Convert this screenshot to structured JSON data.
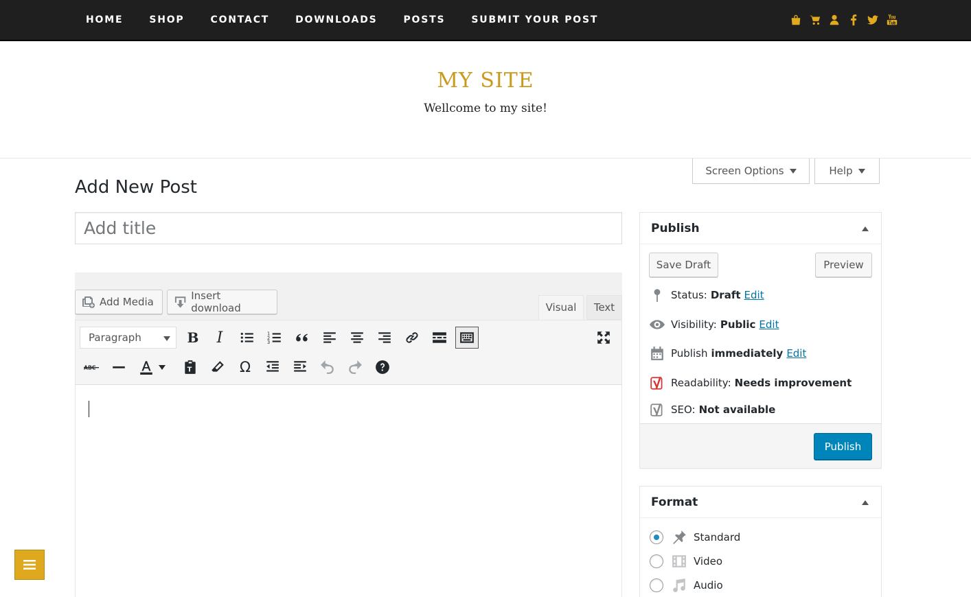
{
  "nav": {
    "items": [
      "HOME",
      "SHOP",
      "CONTACT",
      "DOWNLOADS",
      "POSTS",
      "SUBMIT YOUR POST"
    ],
    "social_icons": [
      "shopping-bag-icon",
      "cart-icon",
      "user-icon",
      "facebook-icon",
      "twitter-icon",
      "youtube-icon"
    ]
  },
  "header": {
    "site_title": "MY SITE",
    "site_description": "Wellcome to my site!"
  },
  "screen_options": {
    "screen_options_label": "Screen Options",
    "help_label": "Help"
  },
  "page": {
    "title": "Add New Post"
  },
  "editor": {
    "title_placeholder": "Add title",
    "add_media_label": "Add Media",
    "insert_download_label": "Insert download",
    "tab_visual": "Visual",
    "tab_text": "Text",
    "format_select_value": "Paragraph",
    "toolbar_row1": [
      "bold",
      "italic",
      "bullet-list",
      "numbered-list",
      "blockquote",
      "align-left",
      "align-center",
      "align-right",
      "link",
      "read-more",
      "toolbar-toggle"
    ],
    "toolbar_row2": [
      "strikethrough",
      "horizontal-line",
      "text-color",
      "paste-as-text",
      "clear-formatting",
      "special-character",
      "outdent",
      "indent",
      "undo",
      "redo",
      "keyboard-shortcuts"
    ]
  },
  "publish_box": {
    "title": "Publish",
    "save_draft_label": "Save Draft",
    "preview_label": "Preview",
    "status_label": "Status:",
    "status_value": "Draft",
    "visibility_label": "Visibility:",
    "visibility_value": "Public",
    "publish_label": "Publish",
    "publish_value": "immediately",
    "edit_label": "Edit",
    "readability_label": "Readability:",
    "readability_value": "Needs improvement",
    "seo_label": "SEO:",
    "seo_value": "Not available",
    "publish_button_label": "Publish"
  },
  "format_box": {
    "title": "Format",
    "options": [
      "Standard",
      "Video",
      "Audio"
    ],
    "selected": "Standard"
  },
  "colors": {
    "accent": "#c99a1c",
    "nav_bg": "#1f1f1f",
    "primary_button": "#0085ba",
    "link": "#0073aa"
  }
}
